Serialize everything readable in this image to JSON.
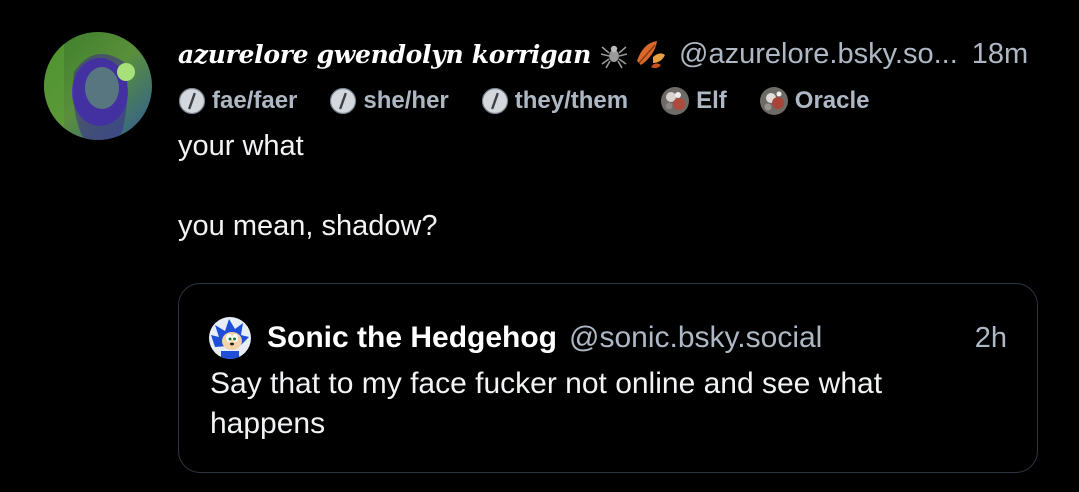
{
  "post": {
    "author": {
      "display_name": "azurelore gwendolyn korrigan",
      "emoji_icons": [
        "spider-icon",
        "autumn-leaves-icon"
      ],
      "handle": "@azurelore.bsky.so...",
      "time": "18m",
      "avatar": "avatar-photo"
    },
    "badges": [
      {
        "label": "fae/faer",
        "icon": "slash-circle-icon"
      },
      {
        "label": "she/her",
        "icon": "slash-circle-icon"
      },
      {
        "label": "they/them",
        "icon": "slash-circle-icon"
      },
      {
        "label": "Elf",
        "icon": "label-avatar-icon"
      },
      {
        "label": "Oracle",
        "icon": "label-avatar-icon"
      }
    ],
    "text_lines": [
      "your what",
      "you mean, shadow?"
    ]
  },
  "quote": {
    "author": {
      "display_name": "Sonic the Hedgehog",
      "handle": "@sonic.bsky.social",
      "time": "2h",
      "avatar": "sonic-avatar"
    },
    "text": "Say that to my face fucker not online and see what happens"
  },
  "colors": {
    "background": "#000000",
    "primary_text": "#f1f3f5",
    "secondary_text": "#aeb8c4",
    "quote_border": "#2e3641"
  }
}
